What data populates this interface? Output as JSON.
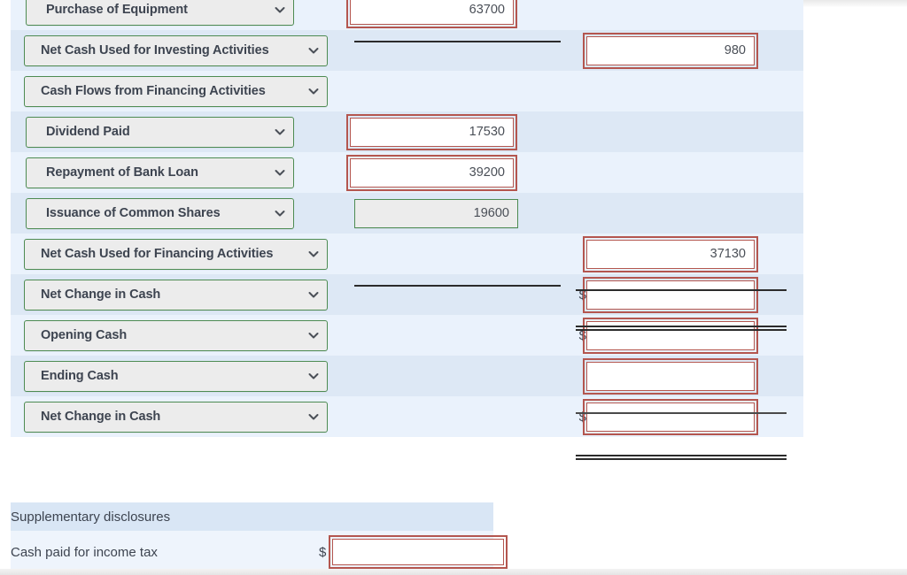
{
  "statement": {
    "rows": [
      {
        "label": "Purchase of Equipment",
        "indent": true,
        "col1": "63700",
        "col1_state": "error",
        "col2": "",
        "col2_state": "none",
        "sign1": "",
        "sign2": "",
        "rule_after_col1": "single"
      },
      {
        "label": "Net Cash Used for Investing Activities",
        "indent": false,
        "col1": "",
        "col1_state": "none",
        "col2": "980",
        "col2_state": "error",
        "sign1": "",
        "sign2": "",
        "rule_after_col1": "none"
      },
      {
        "label": "Cash Flows from Financing Activities",
        "indent": false,
        "col1": "",
        "col1_state": "none",
        "col2": "",
        "col2_state": "none",
        "sign1": "",
        "sign2": "",
        "rule_after_col1": "none"
      },
      {
        "label": "Dividend Paid",
        "indent": true,
        "col1": "17530",
        "col1_state": "error",
        "col2": "",
        "col2_state": "none",
        "sign1": "",
        "sign2": "",
        "rule_after_col1": "none"
      },
      {
        "label": "Repayment of Bank Loan",
        "indent": true,
        "col1": "39200",
        "col1_state": "error",
        "col2": "",
        "col2_state": "none",
        "sign1": "",
        "sign2": "",
        "rule_after_col1": "none"
      },
      {
        "label": "Issuance of Common Shares",
        "indent": true,
        "col1": "19600",
        "col1_state": "readonly",
        "col2": "",
        "col2_state": "none",
        "sign1": "",
        "sign2": "",
        "rule_after_col1": "single"
      },
      {
        "label": "Net Cash Used for Financing Activities",
        "indent": false,
        "col1": "",
        "col1_state": "none",
        "col2": "37130",
        "col2_state": "error",
        "sign1": "",
        "sign2": "",
        "rule_after_col1": "none"
      },
      {
        "label": "Net Change in Cash",
        "indent": false,
        "col1": "",
        "col1_state": "none",
        "col2": "",
        "col2_state": "error",
        "sign1": "",
        "sign2": "$",
        "rule_after_col1": "none"
      },
      {
        "label": "Opening Cash",
        "indent": false,
        "col1": "",
        "col1_state": "none",
        "col2": "",
        "col2_state": "error",
        "sign1": "",
        "sign2": "$",
        "rule_after_col1": "none"
      },
      {
        "label": "Ending Cash",
        "indent": false,
        "col1": "",
        "col1_state": "none",
        "col2": "",
        "col2_state": "error",
        "sign1": "",
        "sign2": "",
        "rule_after_col1": "none"
      },
      {
        "label": "Net Change in Cash",
        "indent": false,
        "col1": "",
        "col1_state": "none",
        "col2": "",
        "col2_state": "error",
        "sign1": "",
        "sign2": "$",
        "rule_after_col1": "none"
      }
    ]
  },
  "supplementary": {
    "title": "Supplementary disclosures",
    "row_label": "Cash paid for income tax",
    "currency_sign": "$",
    "value": ""
  },
  "icons": {
    "chevron": "chevron-down-icon"
  },
  "colors": {
    "error_border": "#b4564f",
    "valid_border": "#4d8b52",
    "row_odd": "#eaf2fc",
    "row_even": "#dde8f5",
    "text": "#3d4450"
  }
}
